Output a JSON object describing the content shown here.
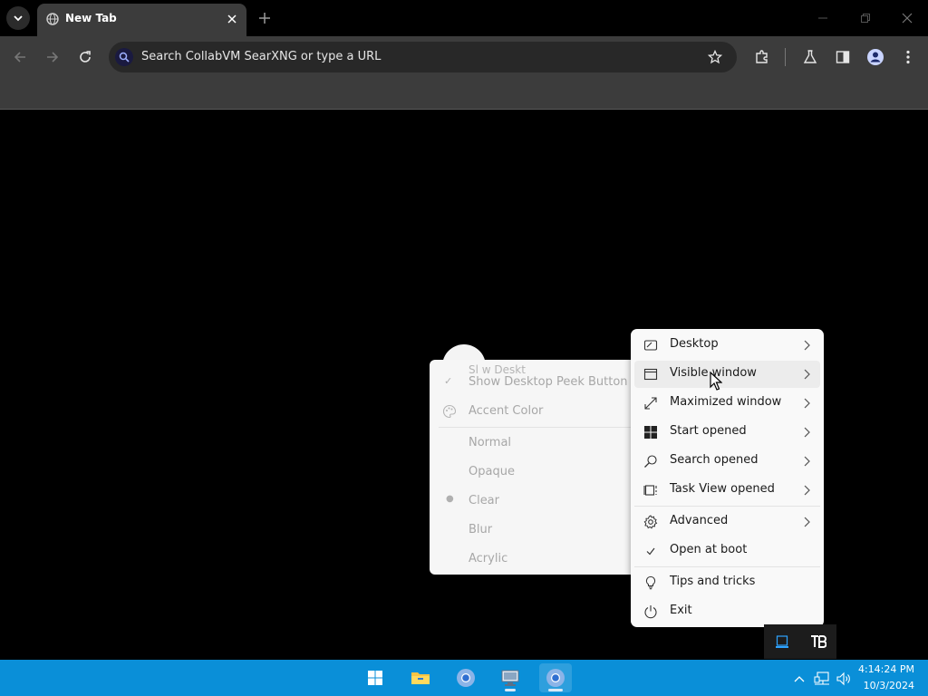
{
  "browser": {
    "tab_title": "New Tab",
    "omnibox_placeholder": "Search CollabVM SearXNG or type a URL"
  },
  "context_menu_left": {
    "ghost_text": "Sl  w Deskt",
    "items": [
      {
        "label": "Show Desktop Peek Button",
        "checked": true
      },
      {
        "label": "Accent Color"
      },
      {
        "label": "Normal"
      },
      {
        "label": "Opaque"
      },
      {
        "label": "Clear",
        "selected": true
      },
      {
        "label": "Blur"
      },
      {
        "label": "Acrylic"
      }
    ]
  },
  "context_menu_right": {
    "items": [
      {
        "label": "Desktop",
        "icon": "desktop-icon",
        "submenu": true
      },
      {
        "label": "Visible window",
        "icon": "window-icon",
        "submenu": true,
        "hovered": true
      },
      {
        "label": "Maximized window",
        "icon": "maximize-arrows-icon",
        "submenu": true
      },
      {
        "label": "Start opened",
        "icon": "windows-logo-icon",
        "submenu": true
      },
      {
        "label": "Search opened",
        "icon": "search-icon",
        "submenu": true
      },
      {
        "label": "Task View opened",
        "icon": "task-view-icon",
        "submenu": true
      },
      {
        "label": "Advanced",
        "icon": "gear-icon",
        "submenu": true
      },
      {
        "label": "Open at boot",
        "icon": "check-icon",
        "checked": true
      },
      {
        "label": "Tips and tricks",
        "icon": "lightbulb-icon"
      },
      {
        "label": "Exit",
        "icon": "power-icon"
      }
    ]
  },
  "taskbar": {
    "time": "4:14:24 PM",
    "date": "10/3/2024",
    "apps": [
      "start-button",
      "file-explorer",
      "chromium",
      "rdp-client",
      "chromium-active"
    ]
  },
  "colors": {
    "taskbar": "#0a8fd8",
    "menu_bg": "#f9f9f9",
    "chrome_toolbar": "#3c3c3c"
  }
}
